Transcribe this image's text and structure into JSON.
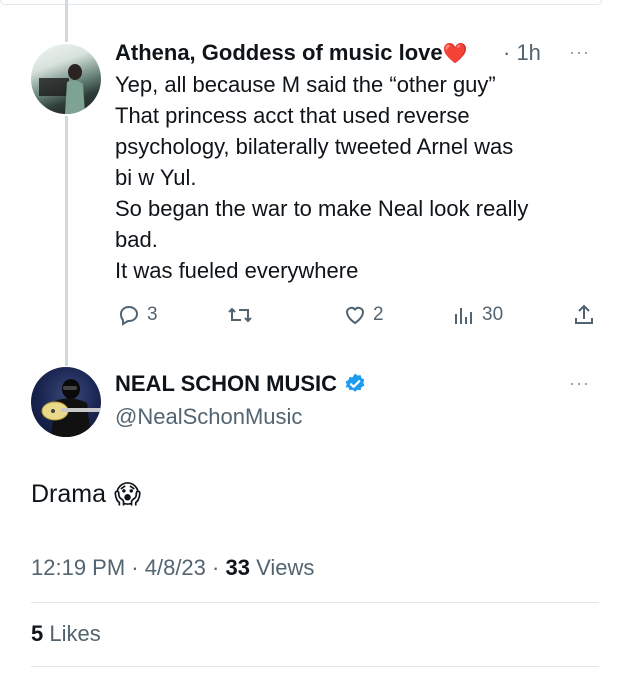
{
  "reply": {
    "author_name": "Athena, Goddess of music love",
    "author_emoji": "❤️",
    "time": "· 1h",
    "lines": [
      "Yep, all because M said the “other guy”",
      "That princess acct that used reverse",
      "psychology, bilaterally tweeted Arnel was",
      "bi w Yul.",
      "So began the war to make Neal look really",
      "bad.",
      "It was fueled everywhere"
    ],
    "actions": {
      "replies": "3",
      "retweets": "",
      "likes": "2",
      "views": "30"
    }
  },
  "main_tweet": {
    "author_name": "NEAL SCHON MUSIC",
    "handle": "@NealSchonMusic",
    "text": "Drama",
    "text_emoji": "😱",
    "time": "12:19 PM",
    "date": "4/8/23",
    "views_count": "33",
    "views_label": "Views",
    "likes_count": "5",
    "likes_label": "Likes"
  },
  "more_label": "···",
  "colors": {
    "verified": "#1d9bf0",
    "muted": "#536471",
    "thread_line": "#cfd9de"
  }
}
